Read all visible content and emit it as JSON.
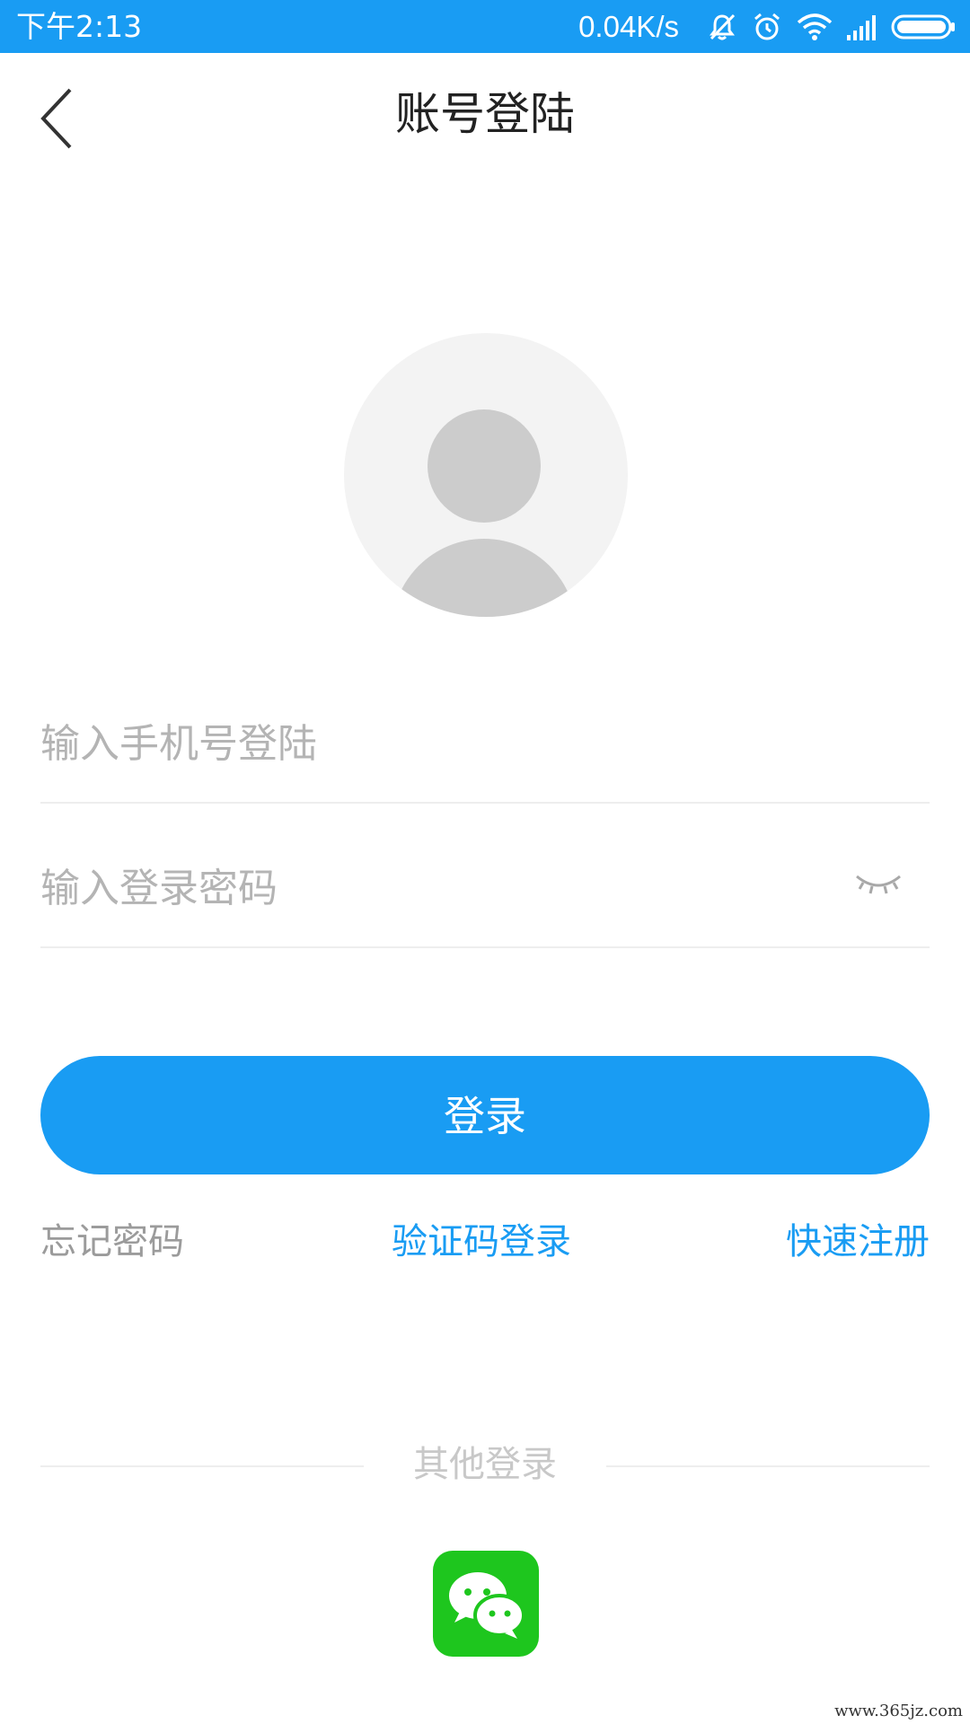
{
  "status_bar": {
    "time": "下午2:13",
    "network_speed": "0.04K/s",
    "icons": [
      "mute-icon",
      "alarm-icon",
      "wifi-icon",
      "signal-icon",
      "battery-icon"
    ],
    "background": "#199cf3"
  },
  "header": {
    "back_icon": "chevron-left-icon",
    "title": "账号登陆"
  },
  "avatar": {
    "icon": "default-user-avatar"
  },
  "form": {
    "phone_placeholder": "输入手机号登陆",
    "phone_value": "",
    "password_placeholder": "输入登录密码",
    "password_value": "",
    "password_toggle_icon": "eye-closed-icon",
    "login_label": "登录"
  },
  "links": {
    "forgot_password": "忘记密码",
    "sms_login": "验证码登录",
    "quick_register": "快速注册"
  },
  "other_login": {
    "label": "其他登录",
    "wechat_icon": "wechat-icon"
  },
  "watermark": "www.365jz.com",
  "colors": {
    "accent": "#199cf3",
    "wechat": "#1ec61e"
  }
}
